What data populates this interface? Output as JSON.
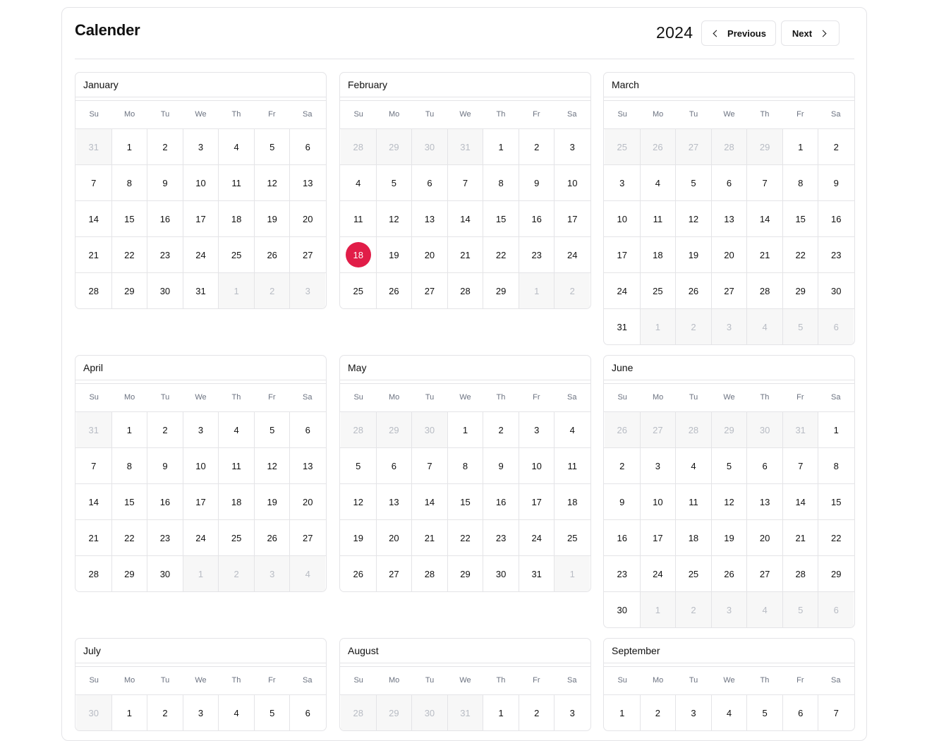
{
  "header": {
    "title": "Calender",
    "year": "2024",
    "previous_label": "Previous",
    "next_label": "Next"
  },
  "colors": {
    "today": "#e11d48",
    "border": "#e4e4e7",
    "muted_bg": "#f7f7f7",
    "muted_text": "#b8bcc4"
  },
  "weekdays": [
    "Su",
    "Mo",
    "Tu",
    "We",
    "Th",
    "Fr",
    "Sa"
  ],
  "today": {
    "month": "February",
    "day": "18"
  },
  "months": [
    {
      "name": "January",
      "weeks": [
        [
          {
            "d": "31",
            "m": true
          },
          {
            "d": "1"
          },
          {
            "d": "2"
          },
          {
            "d": "3"
          },
          {
            "d": "4"
          },
          {
            "d": "5"
          },
          {
            "d": "6"
          }
        ],
        [
          {
            "d": "7"
          },
          {
            "d": "8"
          },
          {
            "d": "9"
          },
          {
            "d": "10"
          },
          {
            "d": "11"
          },
          {
            "d": "12"
          },
          {
            "d": "13"
          }
        ],
        [
          {
            "d": "14"
          },
          {
            "d": "15"
          },
          {
            "d": "16"
          },
          {
            "d": "17"
          },
          {
            "d": "18"
          },
          {
            "d": "19"
          },
          {
            "d": "20"
          }
        ],
        [
          {
            "d": "21"
          },
          {
            "d": "22"
          },
          {
            "d": "23"
          },
          {
            "d": "24"
          },
          {
            "d": "25"
          },
          {
            "d": "26"
          },
          {
            "d": "27"
          }
        ],
        [
          {
            "d": "28"
          },
          {
            "d": "29"
          },
          {
            "d": "30"
          },
          {
            "d": "31"
          },
          {
            "d": "1",
            "m": true
          },
          {
            "d": "2",
            "m": true
          },
          {
            "d": "3",
            "m": true
          }
        ]
      ]
    },
    {
      "name": "February",
      "weeks": [
        [
          {
            "d": "28",
            "m": true
          },
          {
            "d": "29",
            "m": true
          },
          {
            "d": "30",
            "m": true
          },
          {
            "d": "31",
            "m": true
          },
          {
            "d": "1"
          },
          {
            "d": "2"
          },
          {
            "d": "3"
          }
        ],
        [
          {
            "d": "4"
          },
          {
            "d": "5"
          },
          {
            "d": "6"
          },
          {
            "d": "7"
          },
          {
            "d": "8"
          },
          {
            "d": "9"
          },
          {
            "d": "10"
          }
        ],
        [
          {
            "d": "11"
          },
          {
            "d": "12"
          },
          {
            "d": "13"
          },
          {
            "d": "14"
          },
          {
            "d": "15"
          },
          {
            "d": "16"
          },
          {
            "d": "17"
          }
        ],
        [
          {
            "d": "18",
            "t": true
          },
          {
            "d": "19"
          },
          {
            "d": "20"
          },
          {
            "d": "21"
          },
          {
            "d": "22"
          },
          {
            "d": "23"
          },
          {
            "d": "24"
          }
        ],
        [
          {
            "d": "25"
          },
          {
            "d": "26"
          },
          {
            "d": "27"
          },
          {
            "d": "28"
          },
          {
            "d": "29"
          },
          {
            "d": "1",
            "m": true
          },
          {
            "d": "2",
            "m": true
          }
        ]
      ]
    },
    {
      "name": "March",
      "weeks": [
        [
          {
            "d": "25",
            "m": true
          },
          {
            "d": "26",
            "m": true
          },
          {
            "d": "27",
            "m": true
          },
          {
            "d": "28",
            "m": true
          },
          {
            "d": "29",
            "m": true
          },
          {
            "d": "1"
          },
          {
            "d": "2"
          }
        ],
        [
          {
            "d": "3"
          },
          {
            "d": "4"
          },
          {
            "d": "5"
          },
          {
            "d": "6"
          },
          {
            "d": "7"
          },
          {
            "d": "8"
          },
          {
            "d": "9"
          }
        ],
        [
          {
            "d": "10"
          },
          {
            "d": "11"
          },
          {
            "d": "12"
          },
          {
            "d": "13"
          },
          {
            "d": "14"
          },
          {
            "d": "15"
          },
          {
            "d": "16"
          }
        ],
        [
          {
            "d": "17"
          },
          {
            "d": "18"
          },
          {
            "d": "19"
          },
          {
            "d": "20"
          },
          {
            "d": "21"
          },
          {
            "d": "22"
          },
          {
            "d": "23"
          }
        ],
        [
          {
            "d": "24"
          },
          {
            "d": "25"
          },
          {
            "d": "26"
          },
          {
            "d": "27"
          },
          {
            "d": "28"
          },
          {
            "d": "29"
          },
          {
            "d": "30"
          }
        ],
        [
          {
            "d": "31"
          },
          {
            "d": "1",
            "m": true
          },
          {
            "d": "2",
            "m": true
          },
          {
            "d": "3",
            "m": true
          },
          {
            "d": "4",
            "m": true
          },
          {
            "d": "5",
            "m": true
          },
          {
            "d": "6",
            "m": true
          }
        ]
      ]
    },
    {
      "name": "April",
      "weeks": [
        [
          {
            "d": "31",
            "m": true
          },
          {
            "d": "1"
          },
          {
            "d": "2"
          },
          {
            "d": "3"
          },
          {
            "d": "4"
          },
          {
            "d": "5"
          },
          {
            "d": "6"
          }
        ],
        [
          {
            "d": "7"
          },
          {
            "d": "8"
          },
          {
            "d": "9"
          },
          {
            "d": "10"
          },
          {
            "d": "11"
          },
          {
            "d": "12"
          },
          {
            "d": "13"
          }
        ],
        [
          {
            "d": "14"
          },
          {
            "d": "15"
          },
          {
            "d": "16"
          },
          {
            "d": "17"
          },
          {
            "d": "18"
          },
          {
            "d": "19"
          },
          {
            "d": "20"
          }
        ],
        [
          {
            "d": "21"
          },
          {
            "d": "22"
          },
          {
            "d": "23"
          },
          {
            "d": "24"
          },
          {
            "d": "25"
          },
          {
            "d": "26"
          },
          {
            "d": "27"
          }
        ],
        [
          {
            "d": "28"
          },
          {
            "d": "29"
          },
          {
            "d": "30"
          },
          {
            "d": "1",
            "m": true
          },
          {
            "d": "2",
            "m": true
          },
          {
            "d": "3",
            "m": true
          },
          {
            "d": "4",
            "m": true
          }
        ]
      ]
    },
    {
      "name": "May",
      "weeks": [
        [
          {
            "d": "28",
            "m": true
          },
          {
            "d": "29",
            "m": true
          },
          {
            "d": "30",
            "m": true
          },
          {
            "d": "1"
          },
          {
            "d": "2"
          },
          {
            "d": "3"
          },
          {
            "d": "4"
          }
        ],
        [
          {
            "d": "5"
          },
          {
            "d": "6"
          },
          {
            "d": "7"
          },
          {
            "d": "8"
          },
          {
            "d": "9"
          },
          {
            "d": "10"
          },
          {
            "d": "11"
          }
        ],
        [
          {
            "d": "12"
          },
          {
            "d": "13"
          },
          {
            "d": "14"
          },
          {
            "d": "15"
          },
          {
            "d": "16"
          },
          {
            "d": "17"
          },
          {
            "d": "18"
          }
        ],
        [
          {
            "d": "19"
          },
          {
            "d": "20"
          },
          {
            "d": "21"
          },
          {
            "d": "22"
          },
          {
            "d": "23"
          },
          {
            "d": "24"
          },
          {
            "d": "25"
          }
        ],
        [
          {
            "d": "26"
          },
          {
            "d": "27"
          },
          {
            "d": "28"
          },
          {
            "d": "29"
          },
          {
            "d": "30"
          },
          {
            "d": "31"
          },
          {
            "d": "1",
            "m": true
          }
        ]
      ]
    },
    {
      "name": "June",
      "weeks": [
        [
          {
            "d": "26",
            "m": true
          },
          {
            "d": "27",
            "m": true
          },
          {
            "d": "28",
            "m": true
          },
          {
            "d": "29",
            "m": true
          },
          {
            "d": "30",
            "m": true
          },
          {
            "d": "31",
            "m": true
          },
          {
            "d": "1"
          }
        ],
        [
          {
            "d": "2"
          },
          {
            "d": "3"
          },
          {
            "d": "4"
          },
          {
            "d": "5"
          },
          {
            "d": "6"
          },
          {
            "d": "7"
          },
          {
            "d": "8"
          }
        ],
        [
          {
            "d": "9"
          },
          {
            "d": "10"
          },
          {
            "d": "11"
          },
          {
            "d": "12"
          },
          {
            "d": "13"
          },
          {
            "d": "14"
          },
          {
            "d": "15"
          }
        ],
        [
          {
            "d": "16"
          },
          {
            "d": "17"
          },
          {
            "d": "18"
          },
          {
            "d": "19"
          },
          {
            "d": "20"
          },
          {
            "d": "21"
          },
          {
            "d": "22"
          }
        ],
        [
          {
            "d": "23"
          },
          {
            "d": "24"
          },
          {
            "d": "25"
          },
          {
            "d": "26"
          },
          {
            "d": "27"
          },
          {
            "d": "28"
          },
          {
            "d": "29"
          }
        ],
        [
          {
            "d": "30"
          },
          {
            "d": "1",
            "m": true
          },
          {
            "d": "2",
            "m": true
          },
          {
            "d": "3",
            "m": true
          },
          {
            "d": "4",
            "m": true
          },
          {
            "d": "5",
            "m": true
          },
          {
            "d": "6",
            "m": true
          }
        ]
      ]
    },
    {
      "name": "July",
      "weeks": [
        [
          {
            "d": "30",
            "m": true
          },
          {
            "d": "1"
          },
          {
            "d": "2"
          },
          {
            "d": "3"
          },
          {
            "d": "4"
          },
          {
            "d": "5"
          },
          {
            "d": "6"
          }
        ]
      ]
    },
    {
      "name": "August",
      "weeks": [
        [
          {
            "d": "28",
            "m": true
          },
          {
            "d": "29",
            "m": true
          },
          {
            "d": "30",
            "m": true
          },
          {
            "d": "31",
            "m": true
          },
          {
            "d": "1"
          },
          {
            "d": "2"
          },
          {
            "d": "3"
          }
        ]
      ]
    },
    {
      "name": "September",
      "weeks": [
        [
          {
            "d": "1"
          },
          {
            "d": "2"
          },
          {
            "d": "3"
          },
          {
            "d": "4"
          },
          {
            "d": "5"
          },
          {
            "d": "6"
          },
          {
            "d": "7"
          }
        ]
      ]
    }
  ]
}
